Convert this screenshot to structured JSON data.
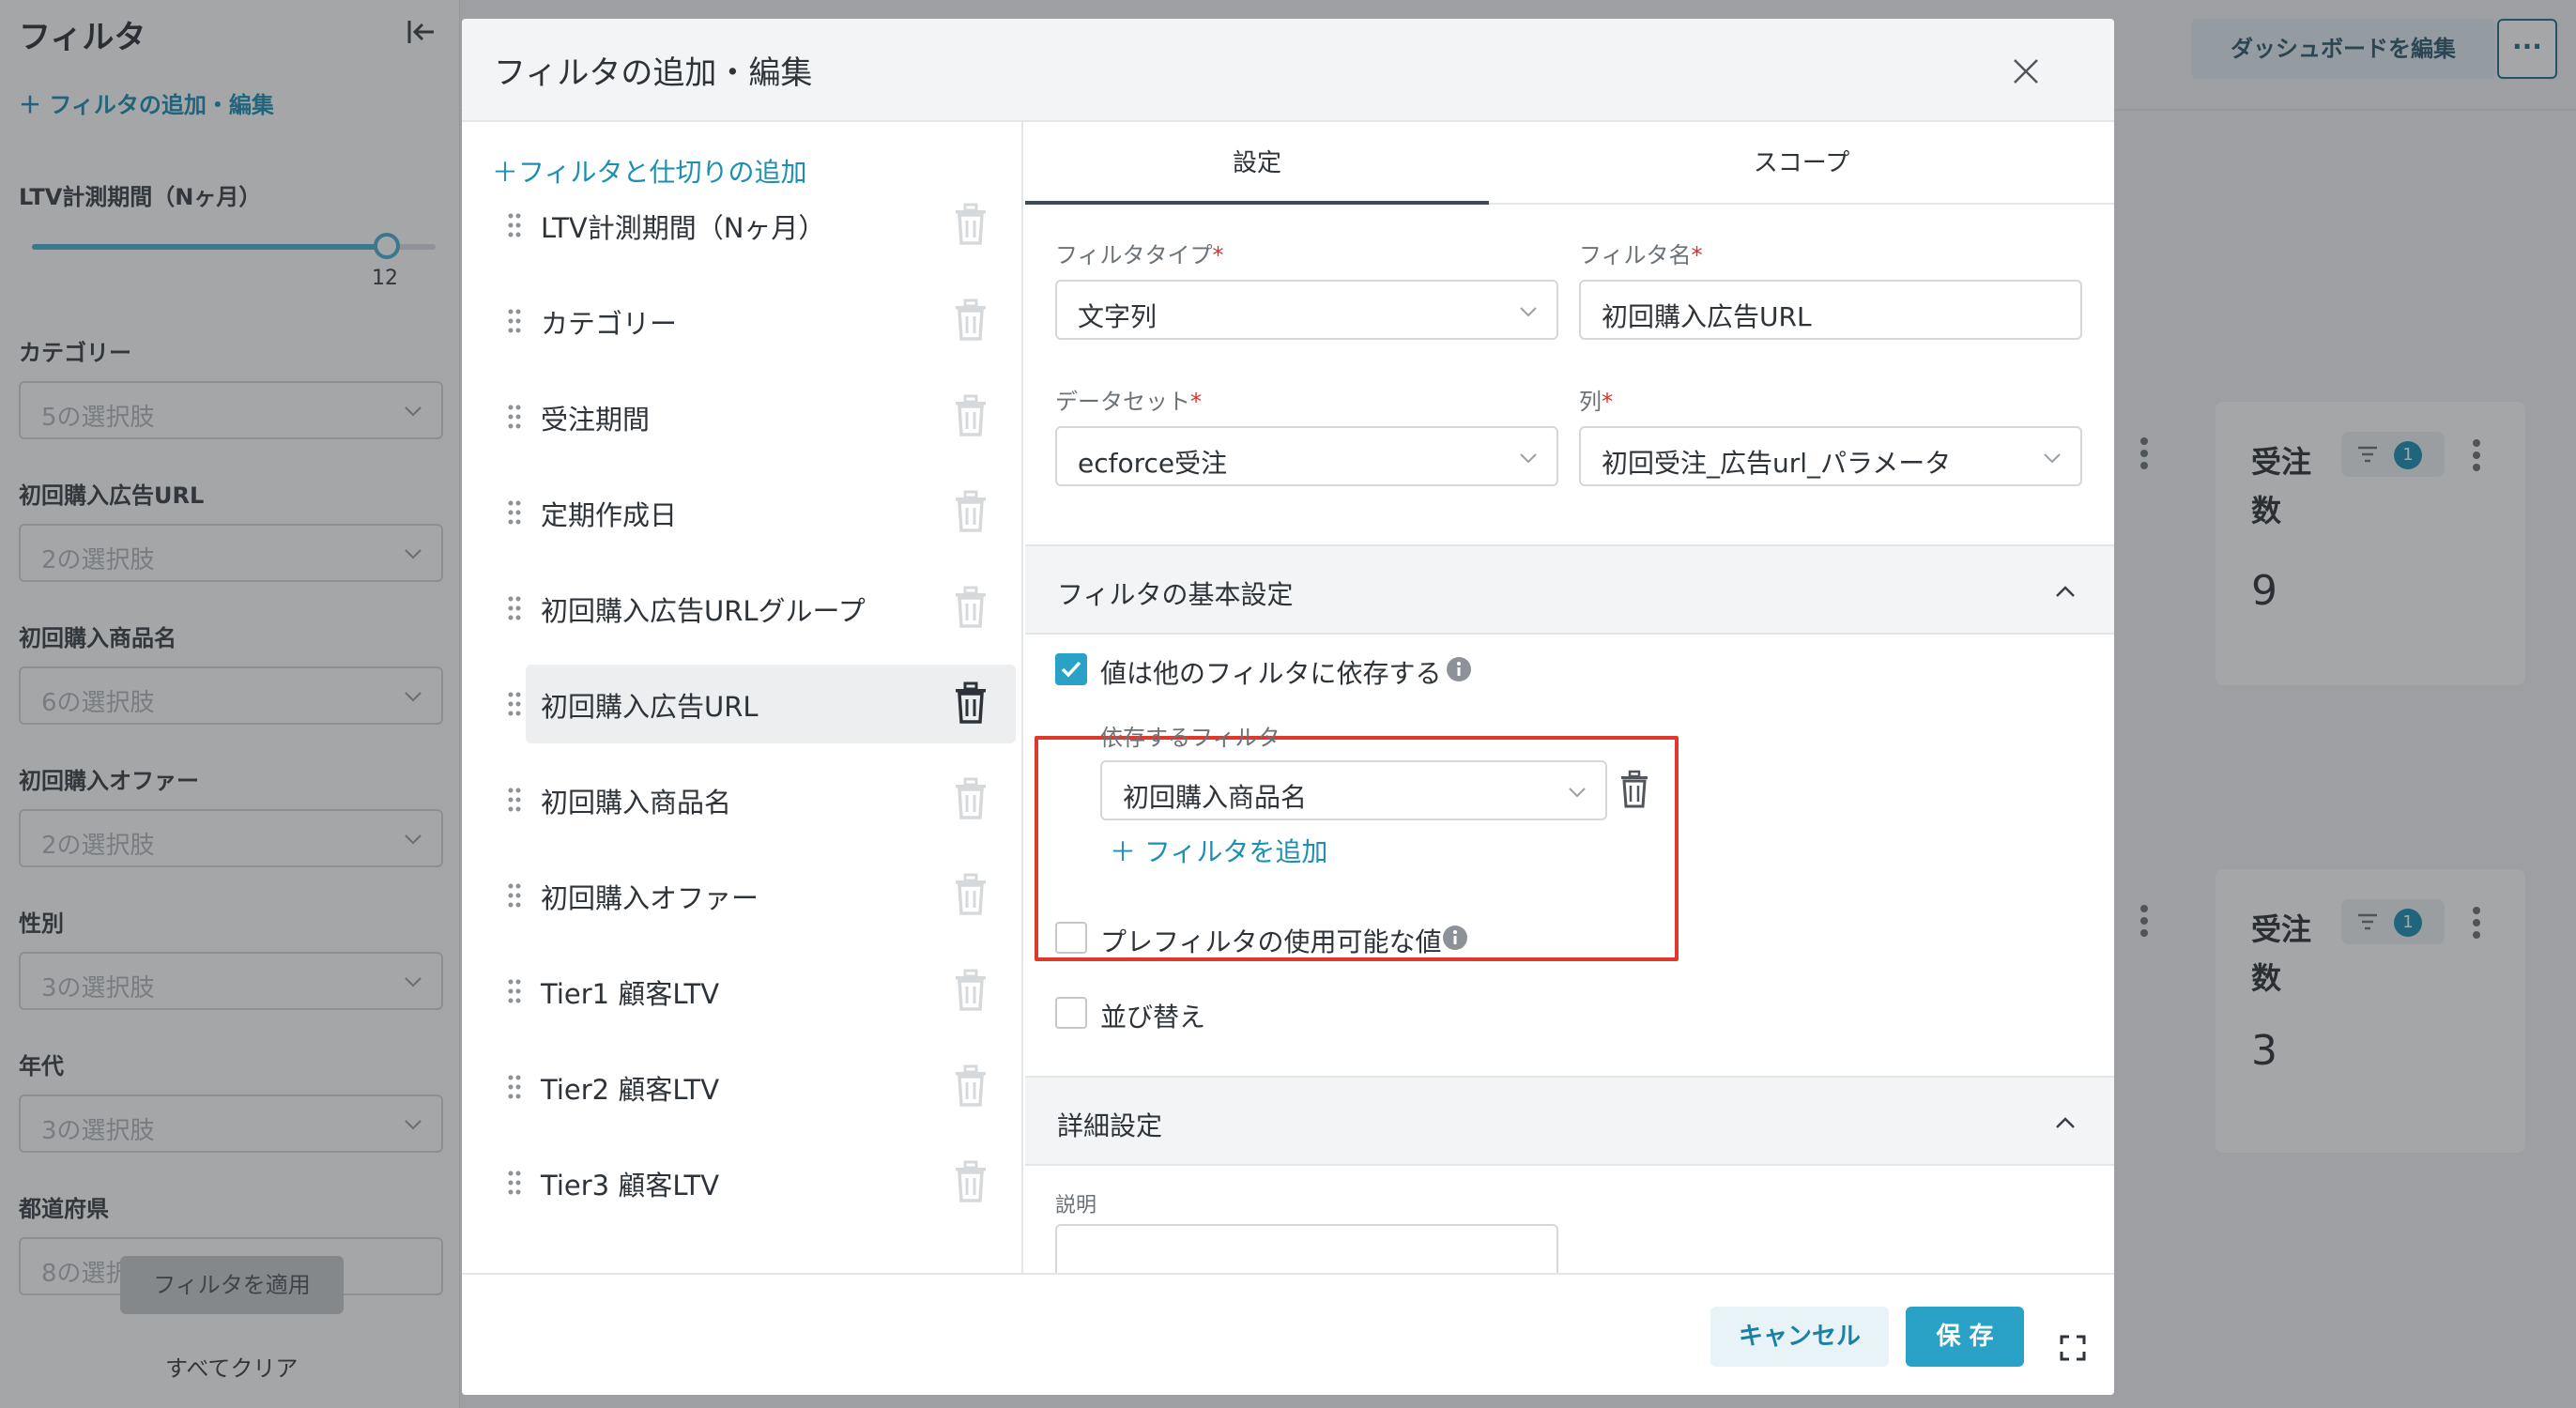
{
  "sidebar": {
    "title": "フィルタ",
    "add_label": "＋  フィルタの追加・編集",
    "ltv_label": "LTV計測期間（Nヶ月）",
    "slider_value": "12",
    "slider_fraction": 0.9,
    "groups": [
      {
        "label": "カテゴリー",
        "value": "5の選択肢"
      },
      {
        "label": "初回購入広告URL",
        "value": "2の選択肢"
      },
      {
        "label": "初回購入商品名",
        "value": "6の選択肢"
      },
      {
        "label": "初回購入オファー",
        "value": "2の選択肢"
      },
      {
        "label": "性別",
        "value": "3の選択肢"
      },
      {
        "label": "年代",
        "value": "3の選択肢"
      },
      {
        "label": "都道府県",
        "value": "8の選択肢"
      }
    ],
    "apply_label": "フィルタを適用",
    "clear_label": "すべてクリア"
  },
  "dashboard": {
    "edit_button": "ダッシュボードを編集",
    "more_button": "···",
    "cards": [
      {
        "title": "受注数",
        "filter_count": "1",
        "value": "9"
      },
      {
        "title": "受注数",
        "filter_count": "1",
        "value": "3"
      }
    ]
  },
  "modal": {
    "title": "フィルタの追加・編集",
    "add_filter_divider": "フィルタと仕切りの追加",
    "filters": [
      "LTV計測期間（Nヶ月）",
      "カテゴリー",
      "受注期間",
      "定期作成日",
      "初回購入広告URLグループ",
      "初回購入広告URL",
      "初回購入商品名",
      "初回購入オファー",
      "Tier1 顧客LTV",
      "Tier2 顧客LTV",
      "Tier3 顧客LTV"
    ],
    "active_filter_index": 5,
    "tabs": {
      "settings": "設定",
      "scope": "スコープ"
    },
    "form": {
      "filter_type_label": "フィルタタイプ",
      "filter_type_value": "文字列",
      "filter_name_label": "フィルタ名",
      "filter_name_value": "初回購入広告URL",
      "dataset_label": "データセット",
      "dataset_value": "ecforce受注",
      "column_label": "列",
      "column_value": "初回受注_広告url_パラメータ",
      "required_mark": "*"
    },
    "basic_section": {
      "title": "フィルタの基本設定",
      "depends_label": "値は他のフィルタに依存する",
      "depends_checked": true,
      "dependent_filter_label": "依存するフィルタ",
      "dependent_filter_value": "初回購入商品名",
      "add_filter_label": "フィルタを追加",
      "prefilter_label": "プレフィルタの使用可能な値",
      "prefilter_checked": false,
      "sort_label": "並び替え",
      "sort_checked": false
    },
    "advanced_section": {
      "title": "詳細設定",
      "description_label": "説明"
    },
    "footer": {
      "cancel": "キャンセル",
      "save": "保 存"
    }
  }
}
